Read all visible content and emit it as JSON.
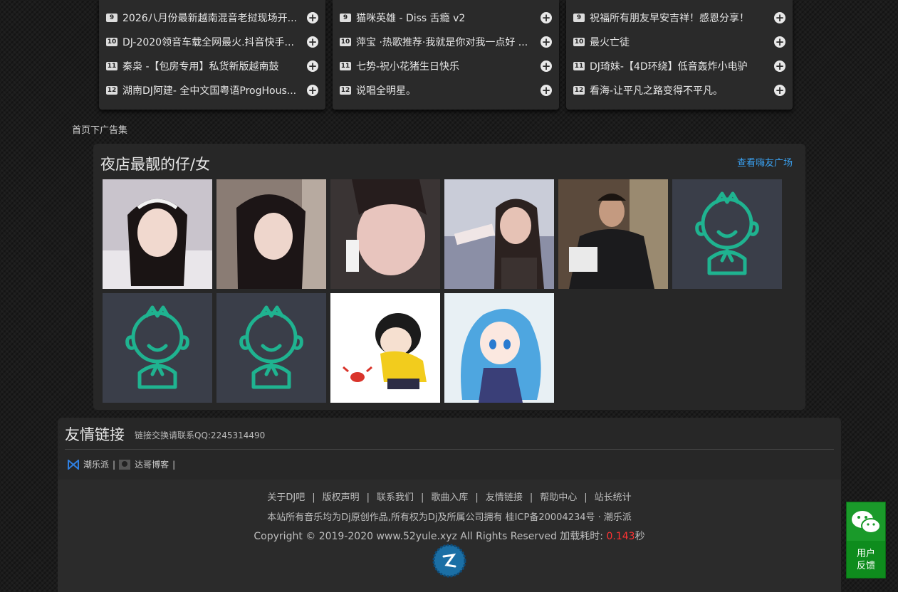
{
  "rank_lists": [
    {
      "items": [
        {
          "num": "9",
          "title": "2026八月份最新越南混音老挝现场开..."
        },
        {
          "num": "10",
          "title": "DJ-2020领音车载全网最火.抖音快手..."
        },
        {
          "num": "11",
          "title": "秦枭 -【包房专用】私货新版越南鼓"
        },
        {
          "num": "12",
          "title": "湖南DJ阿建- 全中文国粤语ProgHous..."
        }
      ]
    },
    {
      "items": [
        {
          "num": "9",
          "title": "猫咪英雄 - Diss 舌瘾 v2"
        },
        {
          "num": "10",
          "title": "萍宝 ·热歌推荐·我就是你对我一点好 ..."
        },
        {
          "num": "11",
          "title": "七势-祝小花猪生日快乐"
        },
        {
          "num": "12",
          "title": "说唱全明星。"
        }
      ]
    },
    {
      "items": [
        {
          "num": "9",
          "title": "祝福所有朋友早安吉祥！感恩分享！"
        },
        {
          "num": "10",
          "title": "最火亡徒"
        },
        {
          "num": "11",
          "title": "DJ琦妹-【4D环绕】低音轰炸小电驴"
        },
        {
          "num": "12",
          "title": "看海-让平凡之路变得不平凡。"
        }
      ]
    }
  ],
  "ad_label": "首页下广告集",
  "gallery": {
    "title": "夜店最靓的仔/女",
    "link": "查看嗨友广场"
  },
  "friends": {
    "title": "友情链接",
    "note": "链接交换请联系QQ:2245314490",
    "links": [
      "潮乐派",
      "达哥博客"
    ],
    "separator": "|"
  },
  "footer": {
    "nav": [
      "关于DJ吧",
      "版权声明",
      "联系我们",
      "歌曲入库",
      "友情链接",
      "帮助中心",
      "站长统计"
    ],
    "nav_sep": "|",
    "line2": "本站所有音乐均为Dj原创作品,所有权为Dj及所属公司拥有 桂ICP备20004234号 · 潮乐派",
    "line3_prefix": "Copyright © 2019-2020 www.52yule.xyz All Rights Reserved 加载耗时: ",
    "load_time": "0.143",
    "line3_suffix": "秒"
  },
  "feedback": {
    "line1": "用户",
    "line2": "反馈"
  },
  "colors": {
    "accent_link": "#3aa0ef",
    "load_time": "#ff3333",
    "feedback_bg": "#0e8c1d",
    "avatar_teal": "#1fb390"
  }
}
